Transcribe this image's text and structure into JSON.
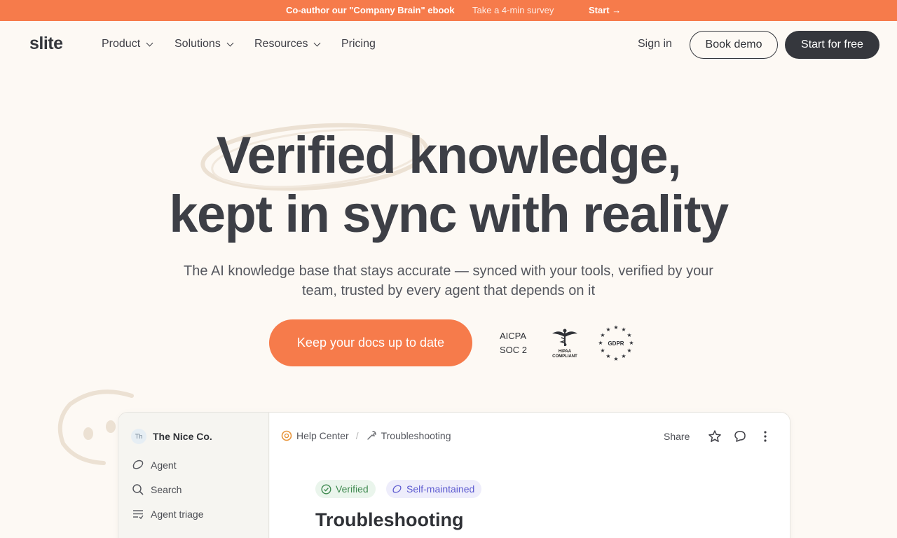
{
  "announcement": {
    "title": "Co-author our \"Company Brain\" ebook",
    "subtitle": "Take a 4-min survey",
    "cta": "Start →"
  },
  "header": {
    "logo": "slite",
    "nav": [
      {
        "label": "Product",
        "has_dropdown": true
      },
      {
        "label": "Solutions",
        "has_dropdown": true
      },
      {
        "label": "Resources",
        "has_dropdown": true
      },
      {
        "label": "Pricing",
        "has_dropdown": false
      }
    ],
    "sign_in": "Sign in",
    "book_demo": "Book demo",
    "start_free": "Start for free"
  },
  "hero": {
    "title_line1": "Verified knowledge,",
    "title_line2": "kept in sync with reality",
    "subtitle": "The AI knowledge base that stays accurate — synced with your tools, verified by your team, trusted by every agent that depends on it",
    "cta": "Keep your docs up to date",
    "badges": {
      "aicpa_line1": "AICPA",
      "aicpa_line2": "SOC 2",
      "hipaa_line1": "HIPAA",
      "hipaa_line2": "COMPLIANT",
      "gdpr": "GDPR"
    }
  },
  "app_preview": {
    "workspace": {
      "initials": "Th",
      "name": "The Nice Co."
    },
    "sidebar": [
      {
        "label": "Agent",
        "icon": "agent-icon"
      },
      {
        "label": "Search",
        "icon": "search-icon"
      },
      {
        "label": "Agent triage",
        "icon": "triage-icon"
      }
    ],
    "breadcrumb": [
      {
        "label": "Help Center",
        "icon": "lifebuoy-icon"
      },
      {
        "label": "Troubleshooting",
        "icon": "wrench-icon"
      }
    ],
    "share": "Share",
    "tags": {
      "verified": "Verified",
      "self_maintained": "Self-maintained"
    },
    "doc_title": "Troubleshooting"
  },
  "colors": {
    "accent": "#f67b4b",
    "dark": "#35373d",
    "background": "#fdf9f4",
    "verified": "#3f8a50",
    "self_maintained": "#5c5ad0"
  }
}
